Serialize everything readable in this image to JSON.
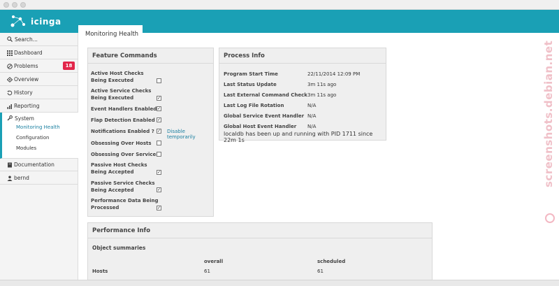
{
  "header": {
    "logo_text": "icinga",
    "active_tab": "Monitoring Health"
  },
  "sidebar": {
    "search_placeholder": "Search...",
    "items": [
      {
        "label": "Dashboard",
        "icon": "dashboard-icon"
      },
      {
        "label": "Problems",
        "icon": "problems-icon",
        "badge": "18"
      },
      {
        "label": "Overview",
        "icon": "overview-icon"
      },
      {
        "label": "History",
        "icon": "history-icon"
      },
      {
        "label": "Reporting",
        "icon": "reporting-icon"
      },
      {
        "label": "System",
        "icon": "wrench-icon"
      },
      {
        "label": "Documentation",
        "icon": "book-icon"
      },
      {
        "label": "bernd",
        "icon": "user-icon"
      }
    ],
    "system_sub": [
      "Monitoring Health",
      "Configuration",
      "Modules"
    ]
  },
  "feature_commands": {
    "title": "Feature Commands",
    "items": [
      {
        "label_1": "Active Host Checks",
        "label_2": "Being Executed",
        "checked": false
      },
      {
        "label_1": "Active Service Checks",
        "label_2": "Being Executed",
        "checked": true
      },
      {
        "label_1": "Event Handlers Enabled",
        "label_2": "",
        "checked": true
      },
      {
        "label_1": "Flap Detection Enabled",
        "label_2": "",
        "checked": true
      },
      {
        "label_1": "Notifications Enabled ?",
        "label_2": "",
        "checked": true
      },
      {
        "label_1": "Obsessing Over Hosts",
        "label_2": "",
        "checked": false
      },
      {
        "label_1": "Obsessing Over Services",
        "label_2": "",
        "checked": false
      },
      {
        "label_1": "Passive Host Checks",
        "label_2": "Being Accepted",
        "checked": true
      },
      {
        "label_1": "Passive Service Checks",
        "label_2": "Being Accepted",
        "checked": true
      },
      {
        "label_1": "Performance Data Being",
        "label_2": "Processed",
        "checked": true
      }
    ],
    "disable_link": "Disable temporarily"
  },
  "process_info": {
    "title": "Process Info",
    "rows": [
      {
        "label": "Program Start Time",
        "value": "22/11/2014 12:09 PM"
      },
      {
        "label": "Last Status Update",
        "value": "3m 11s ago"
      },
      {
        "label": "Last External Command Check",
        "value": "3m 11s ago"
      },
      {
        "label": "Last Log File Rotation",
        "value": "N/A"
      },
      {
        "label": "Global Service Event Handler",
        "value": "N/A"
      },
      {
        "label": "Global Host Event Handler",
        "value": "N/A"
      }
    ],
    "status_text": "localdb has been up and running with PID 1711 since 22m 1s"
  },
  "performance_info": {
    "title": "Performance Info",
    "subtitle": "Object summaries",
    "col_overall": "overall",
    "col_scheduled": "scheduled",
    "row_hosts": "Hosts",
    "hosts_overall": "61",
    "hosts_scheduled": "61"
  },
  "watermark": "screenshots.debian.net",
  "colors": {
    "accent": "#1aa0b5",
    "badge": "#e2264a",
    "link": "#1a7fa0"
  }
}
